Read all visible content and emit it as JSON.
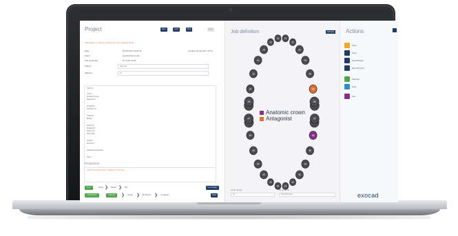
{
  "project_panel": {
    "title": "Project",
    "toolbar": [
      "Save",
      "Load",
      "Print",
      "Clear"
    ],
    "warning": "Information is missing, please fill in the required fields",
    "fields": [
      {
        "label": "Date",
        "value": "01.02.2017 13:34:51",
        "right": "Created: 01.02.2017 13:34"
      },
      {
        "label": "Client",
        "value": "exocad Demo Lab"
      },
      {
        "label": "Lab technician",
        "value": "Dr. John Smith"
      },
      {
        "label": "Patient",
        "value": "Sample"
      },
      {
        "label": "Material",
        "value": "Zr"
      }
    ],
    "list_items": [
      "Tooth 11",
      "Crown",
      "Anatomic crown",
      "Material: Zr",
      "Antagonist",
      "Tooth 36, 37",
      "Tooth 38",
      "Bridge",
      "Pontic 46",
      "Antagonist",
      "Upper jaw",
      "Scan data",
      "Implant",
      "Abutment",
      "Additional information",
      "Notes"
    ],
    "history_title": "Production",
    "history_line": "Tooth 11 Anatomic crown - Antagonist (lower jaw)",
    "workflow": [
      "Scan",
      "Define",
      "Design",
      "Mill"
    ],
    "workflow_steps": [
      "Job definition",
      "Scanning",
      "Design",
      "Production",
      "Completion"
    ],
    "design_button": "Go to Design",
    "close_button": "Close"
  },
  "job_panel": {
    "title": "Job definition",
    "button": "Multi-Die",
    "teeth_upper": [
      "18",
      "17",
      "16",
      "15",
      "14",
      "13",
      "12",
      "11",
      "21",
      "22",
      "23",
      "24",
      "25",
      "26",
      "27",
      "28"
    ],
    "teeth_lower": [
      "48",
      "47",
      "46",
      "45",
      "44",
      "43",
      "42",
      "41",
      "31",
      "32",
      "33",
      "34",
      "35",
      "36",
      "37",
      "38"
    ],
    "legend": [
      {
        "label": "Anatomic crown",
        "color": "#8a2f8e"
      },
      {
        "label": "Antagonist",
        "color": "#e0702e"
      }
    ],
    "footer_left": "Tooth shade",
    "footer_right": "Scan mode",
    "footer_left_value": "A2",
    "footer_right_value": "Separated dies"
  },
  "actions_panel": {
    "title": "Actions",
    "items": [
      {
        "label": "Save",
        "color": "#f0a72a"
      },
      {
        "label": "Open",
        "color": "#1f3c68"
      },
      {
        "label": "Scan/Design",
        "color": "#1f3c68"
      },
      {
        "label": "Export/Import",
        "color": "#1f3c68"
      },
      {
        "label": "Settings",
        "color": "#4fa64a"
      },
      {
        "label": "Help",
        "color": "#2d8ec9"
      },
      {
        "label": "Info",
        "color": "#8a2f8e"
      }
    ],
    "logo": "exocad"
  }
}
